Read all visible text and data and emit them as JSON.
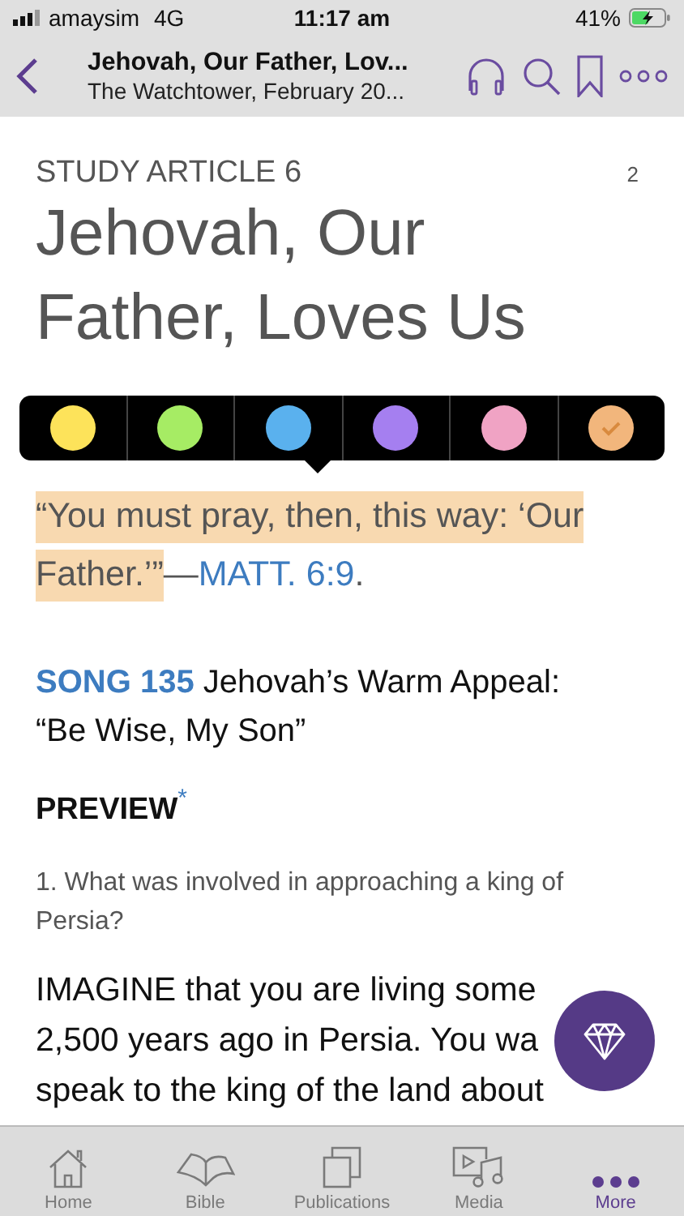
{
  "status_bar": {
    "carrier": "amaysim",
    "network": "4G",
    "time": "11:17 am",
    "battery": "41%"
  },
  "nav": {
    "title": "Jehovah, Our Father, Lov...",
    "subtitle": "The Watchtower, February 20..."
  },
  "article": {
    "label": "STUDY ARTICLE 6",
    "page": "2",
    "title_lines": [
      "Jehovah, Our",
      "Father, Loves Us"
    ]
  },
  "highlight_colors": [
    {
      "color": "#fde35a",
      "selected": false
    },
    {
      "color": "#a6ec64",
      "selected": false
    },
    {
      "color": "#5ab1ee",
      "selected": false
    },
    {
      "color": "#a57ff0",
      "selected": false
    },
    {
      "color": "#f0a3c4",
      "selected": false
    },
    {
      "color": "#f2b67c",
      "selected": true
    }
  ],
  "theme_scripture": {
    "quote_lines": [
      "“You must pray, then, this way: ‘Our",
      "Father.’”"
    ],
    "dash": "—",
    "reference": "MATT. 6:9",
    "end": "."
  },
  "song": {
    "number": "SONG 135",
    "title_line1": "Jehovah’s Warm Appeal:",
    "title_line2": "“Be Wise, My Son”"
  },
  "preview": {
    "heading": "PREVIEW",
    "footnote_mark": "*"
  },
  "question": "1. What was involved in approaching a king of Persia?",
  "paragraph_lines": [
    "IMAGINE that you are living some",
    "2,500 years ago in Persia. You wa",
    "speak to the king of the land about"
  ],
  "tabs": [
    {
      "label": "Home",
      "selected": false
    },
    {
      "label": "Bible",
      "selected": false
    },
    {
      "label": "Publications",
      "selected": false
    },
    {
      "label": "Media",
      "selected": false
    },
    {
      "label": "More",
      "selected": true
    }
  ]
}
